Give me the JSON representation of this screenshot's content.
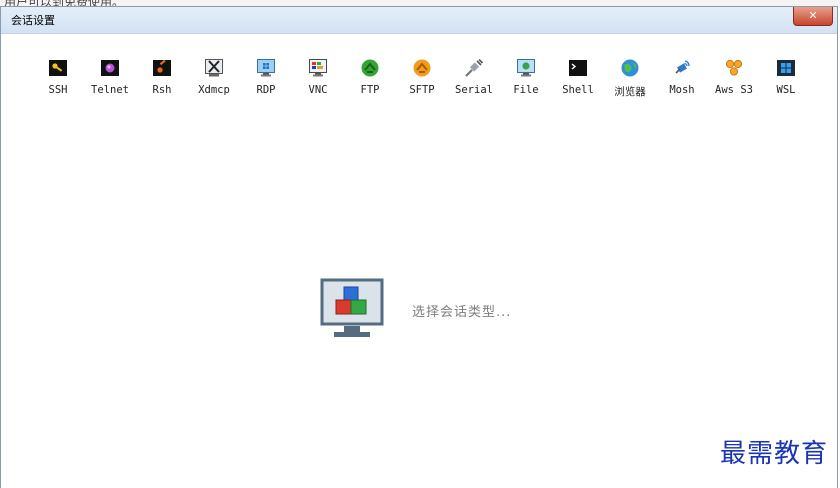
{
  "top_text": "用户可以到免费使用。",
  "window": {
    "title": "会话设置",
    "close_label": "✕"
  },
  "session_types": [
    {
      "label": "SSH",
      "icon": "ssh-key-icon"
    },
    {
      "label": "Telnet",
      "icon": "telnet-icon"
    },
    {
      "label": "Rsh",
      "icon": "rsh-icon"
    },
    {
      "label": "Xdmcp",
      "icon": "xdmcp-icon"
    },
    {
      "label": "RDP",
      "icon": "rdp-monitor-icon"
    },
    {
      "label": "VNC",
      "icon": "vnc-monitor-icon"
    },
    {
      "label": "FTP",
      "icon": "ftp-globe-icon"
    },
    {
      "label": "SFTP",
      "icon": "sftp-globe-icon"
    },
    {
      "label": "Serial",
      "icon": "serial-plug-icon"
    },
    {
      "label": "File",
      "icon": "file-monitor-icon"
    },
    {
      "label": "Shell",
      "icon": "shell-terminal-icon"
    },
    {
      "label": "浏览器",
      "icon": "browser-globe-icon"
    },
    {
      "label": "Mosh",
      "icon": "mosh-satellite-icon"
    },
    {
      "label": "Aws S3",
      "icon": "aws-s3-icon"
    },
    {
      "label": "WSL",
      "icon": "wsl-windows-icon"
    }
  ],
  "placeholder": {
    "text": "选择会话类型..."
  },
  "watermark": "最需教育",
  "colors": {
    "titlebar": "#d3e2f3",
    "close": "#c8452e",
    "watermark": "#1a33b8"
  }
}
